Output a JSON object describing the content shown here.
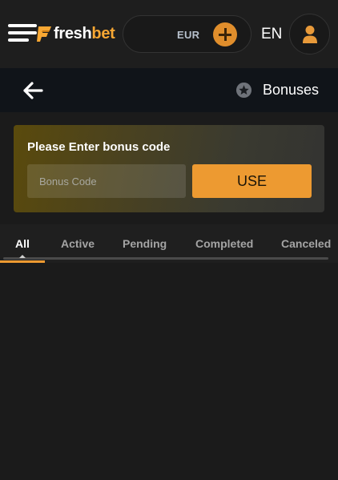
{
  "header": {
    "brand": {
      "part1": "fresh",
      "part2": "bet"
    },
    "balance": {
      "currency": "EUR"
    },
    "language": "EN"
  },
  "subheader": {
    "title": "Bonuses"
  },
  "bonus_code": {
    "title": "Please Enter bonus code",
    "placeholder": "Bonus Code",
    "value": "",
    "button_label": "USE"
  },
  "tabs": [
    {
      "label": "All",
      "active": true
    },
    {
      "label": "Active",
      "active": false
    },
    {
      "label": "Pending",
      "active": false
    },
    {
      "label": "Completed",
      "active": false
    },
    {
      "label": "Canceled",
      "active": false
    }
  ],
  "colors": {
    "accent": "#ed9a31",
    "background": "#1b1b1b",
    "subheader": "#101419"
  }
}
